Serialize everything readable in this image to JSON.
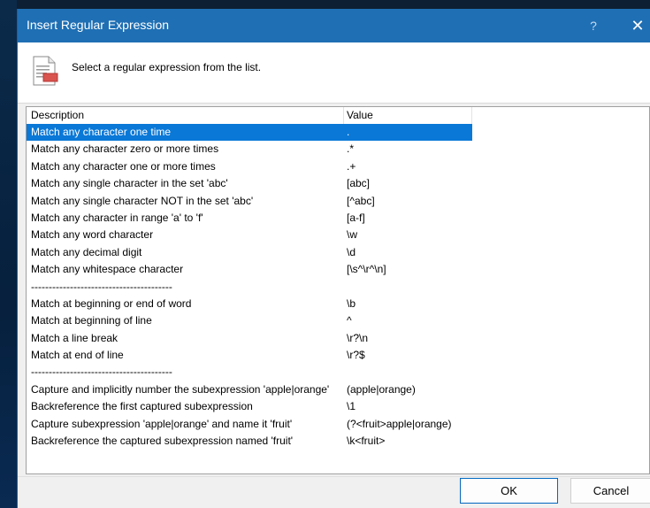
{
  "window": {
    "title": "Insert Regular Expression",
    "help_glyph": "?",
    "close_glyph": "✕"
  },
  "header": {
    "instruction": "Select a regular expression from the list."
  },
  "list": {
    "columns": {
      "description": "Description",
      "value": "Value"
    },
    "selected_index": 0,
    "rows": [
      {
        "description": "Match any character one time",
        "value": "."
      },
      {
        "description": "Match any character zero or more times",
        "value": ".*"
      },
      {
        "description": "Match any character one or more times",
        "value": ".+"
      },
      {
        "description": "Match any single character in the set 'abc'",
        "value": "[abc]"
      },
      {
        "description": "Match any single character NOT in the set 'abc'",
        "value": "[^abc]"
      },
      {
        "description": "Match any character in range 'a' to 'f'",
        "value": "[a-f]"
      },
      {
        "description": "Match any word character",
        "value": "\\w"
      },
      {
        "description": "Match any decimal digit",
        "value": "\\d"
      },
      {
        "description": "Match any whitespace character",
        "value": "[\\s^\\r^\\n]"
      },
      {
        "description": "----------------------------------------",
        "value": ""
      },
      {
        "description": "Match at beginning or end of word",
        "value": "\\b"
      },
      {
        "description": "Match at beginning of line",
        "value": "^"
      },
      {
        "description": "Match a line break",
        "value": "\\r?\\n"
      },
      {
        "description": "Match at end of line",
        "value": "\\r?$"
      },
      {
        "description": "----------------------------------------",
        "value": ""
      },
      {
        "description": "Capture and implicitly number the subexpression 'apple|orange'",
        "value": "(apple|orange)"
      },
      {
        "description": "Backreference the first captured subexpression",
        "value": "\\1"
      },
      {
        "description": "Capture subexpression 'apple|orange' and name it 'fruit'",
        "value": "(?<fruit>apple|orange)"
      },
      {
        "description": "Backreference the captured subexpression named 'fruit'",
        "value": "\\k<fruit>"
      }
    ]
  },
  "buttons": {
    "ok": "OK",
    "cancel": "Cancel"
  },
  "colors": {
    "titlebar": "#1f6fb4",
    "selection": "#0a78d7",
    "ok_border": "#0067c0"
  }
}
